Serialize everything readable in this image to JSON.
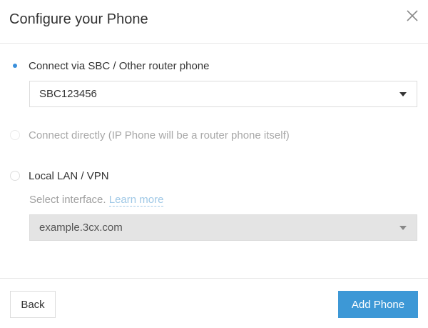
{
  "dialog": {
    "title": "Configure your Phone",
    "close_icon": "close-icon"
  },
  "options": {
    "sbc": {
      "label": "Connect via SBC / Other router phone",
      "checked": true,
      "select_value": "SBC123456"
    },
    "direct": {
      "label": "Connect directly (IP Phone will be a router phone itself)",
      "disabled": true
    },
    "lan": {
      "label": "Local LAN / VPN",
      "helper_text": "Select interface.",
      "helper_link": "Learn more",
      "select_value": "example.3cx.com"
    }
  },
  "footer": {
    "back_label": "Back",
    "add_label": "Add Phone"
  },
  "colors": {
    "accent": "#3d98d6",
    "radio_dot": "#3a8fdb",
    "link": "#9fc8e6"
  }
}
